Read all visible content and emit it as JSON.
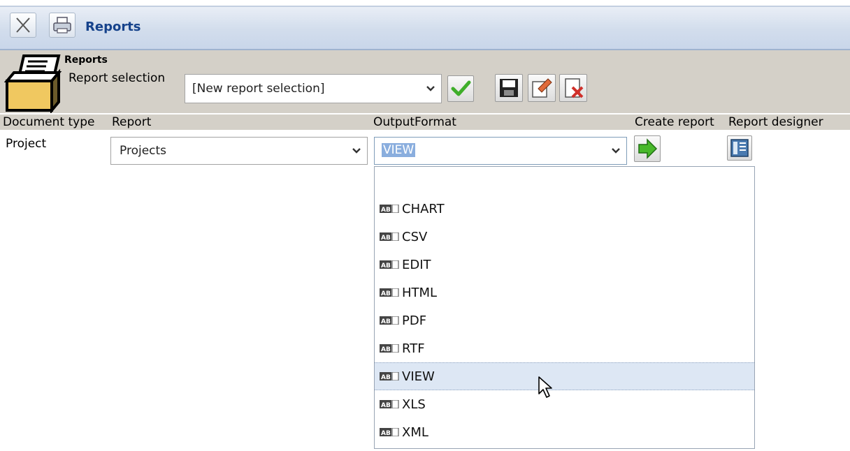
{
  "window": {
    "title": "Reports",
    "close_icon": "close-icon",
    "print_icon": "printer-icon"
  },
  "header": {
    "section_title": "Reports",
    "report_selection_label": "Report selection",
    "report_selection_value": "[New report selection]",
    "icons": [
      "printer-report-icon",
      "checkmark-icon",
      "save-icon",
      "rename-icon",
      "delete-icon"
    ]
  },
  "columns": {
    "document_type": "Document type",
    "report": "Report",
    "output_format": "OutputFormat",
    "create_report": "Create report",
    "report_designer": "Report designer"
  },
  "row": {
    "document_type": "Project",
    "report": "Projects",
    "output_format": "VIEW"
  },
  "dropdown": {
    "options": [
      "",
      "CHART",
      "CSV",
      "EDIT",
      "HTML",
      "PDF",
      "RTF",
      "VIEW",
      "XLS",
      "XML"
    ],
    "selected": "VIEW"
  },
  "colors": {
    "title_text": "#15428b",
    "header_bg": "#d4d0c8",
    "selection_bg": "#dde7f4",
    "accent_green": "#3fae2a"
  }
}
